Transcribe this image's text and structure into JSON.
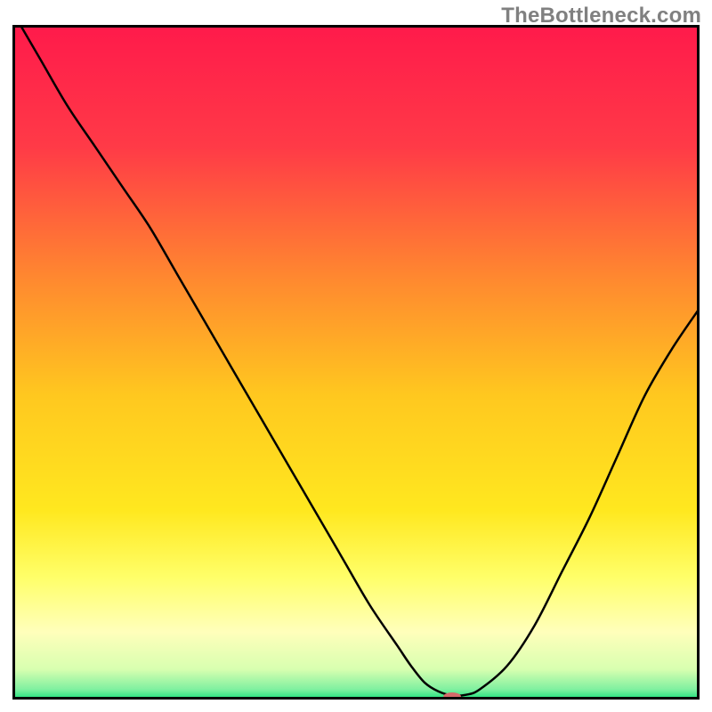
{
  "watermark": "TheBottleneck.com",
  "chart_data": {
    "type": "line",
    "title": "",
    "xlabel": "",
    "ylabel": "",
    "xlim": [
      0,
      100
    ],
    "ylim": [
      0,
      100
    ],
    "gradient_stops": [
      {
        "offset": 0.0,
        "color": "#ff1a4b"
      },
      {
        "offset": 0.18,
        "color": "#ff3a47"
      },
      {
        "offset": 0.38,
        "color": "#ff8a2f"
      },
      {
        "offset": 0.55,
        "color": "#ffc81f"
      },
      {
        "offset": 0.72,
        "color": "#ffe81f"
      },
      {
        "offset": 0.82,
        "color": "#ffff6a"
      },
      {
        "offset": 0.9,
        "color": "#ffffbb"
      },
      {
        "offset": 0.955,
        "color": "#d8ffb0"
      },
      {
        "offset": 0.985,
        "color": "#7ff0a0"
      },
      {
        "offset": 1.0,
        "color": "#18e07a"
      }
    ],
    "series": [
      {
        "name": "bottleneck-curve",
        "x": [
          0,
          4,
          8,
          12,
          16,
          20,
          24,
          28,
          32,
          36,
          40,
          44,
          48,
          52,
          56,
          58,
          60,
          62,
          64,
          66,
          68,
          72,
          76,
          80,
          84,
          88,
          92,
          96,
          100
        ],
        "y": [
          102,
          95,
          88,
          82,
          76,
          70,
          63,
          56,
          49,
          42,
          35,
          28,
          21,
          14,
          8,
          5,
          2.5,
          1.2,
          0.6,
          0.7,
          1.5,
          5,
          11,
          19,
          27,
          36,
          45,
          52,
          58
        ]
      }
    ],
    "marker": {
      "x": 64,
      "y": 0.4,
      "rx": 10,
      "ry": 5
    }
  },
  "annotations": {
    "curve_name": "bottleneck-curve",
    "min_marker_name": "min-marker"
  }
}
